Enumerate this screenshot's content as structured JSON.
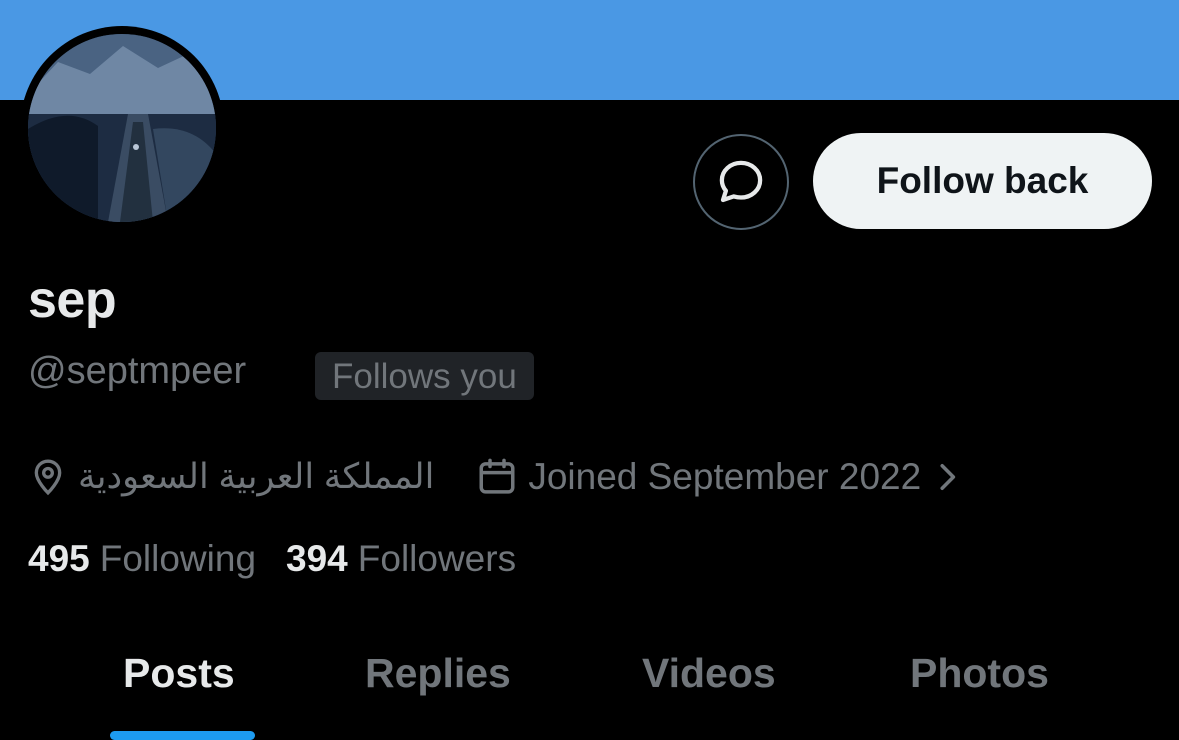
{
  "profile": {
    "display_name": "sep",
    "handle": "@septmpeer",
    "follows_you": "Follows you",
    "location": "المملكة العربية السعودية",
    "joined": "Joined September 2022"
  },
  "actions": {
    "follow_back": "Follow back"
  },
  "stats": {
    "following_count": "495",
    "following_label": "Following",
    "followers_count": "394",
    "followers_label": "Followers"
  },
  "tabs": [
    {
      "label": "Posts",
      "active": true
    },
    {
      "label": "Replies",
      "active": false
    },
    {
      "label": "Videos",
      "active": false
    },
    {
      "label": "Photos",
      "active": false
    }
  ],
  "colors": {
    "banner": "#4a98e4",
    "background": "#000000",
    "accent": "#1d9bf0",
    "secondary_text": "#71767b"
  },
  "icons": {
    "message": "message-bubble-icon",
    "location": "location-pin-icon",
    "calendar": "calendar-icon",
    "chevron": "chevron-right-icon"
  }
}
